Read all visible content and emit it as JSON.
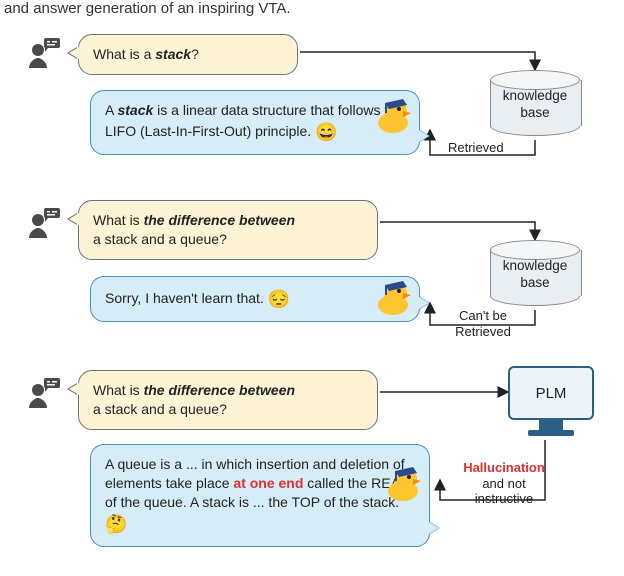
{
  "top_fragment": "and answer generation of an inspiring VTA.",
  "block1": {
    "question_prefix": "What is a ",
    "question_em": "stack",
    "question_suffix": "?",
    "answer_prefix": "A ",
    "answer_em": "stack",
    "answer_rest": " is a linear data structure that follows the LIFO (Last-In-First-Out) principle. ",
    "emoji": "😄",
    "kb_label_line1": "knowledge",
    "kb_label_line2": "base",
    "edge_label": "Retrieved"
  },
  "block2": {
    "question_prefix": "What is ",
    "question_em": "the difference between",
    "question_line2": "a stack and a queue?",
    "answer": "Sorry, I haven't learn that.  ",
    "emoji": "😔",
    "kb_label_line1": "knowledge",
    "kb_label_line2": "base",
    "edge_label_line1": "Can't be",
    "edge_label_line2": "Retrieved"
  },
  "block3": {
    "question_prefix": "What is ",
    "question_em": "the difference between",
    "question_line2": "a stack and a queue?",
    "answer_p1": "A queue is a ... in which insertion and deletion of elements take place ",
    "answer_red": "at one end",
    "answer_p2": " called the REAR of the queue. A stack is ... the TOP of the stack.  ",
    "emoji": "🤔",
    "plm_label": "PLM",
    "edge_label_red": "Hallucination",
    "edge_label_line2": "and not",
    "edge_label_line3": "instructive"
  },
  "icons": {
    "user": "user-chat-icon",
    "bot": "duck-grad-icon"
  }
}
